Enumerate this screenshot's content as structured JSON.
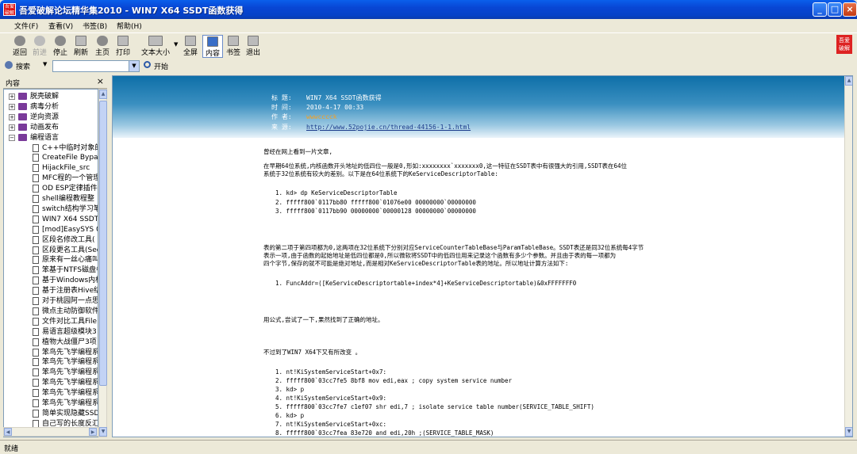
{
  "window": {
    "title": "吾爱破解论坛精华集2010 - WIN7 X64 SSDT函数获得",
    "icon_text": "吾爱破解",
    "controls": [
      "_",
      "□",
      "×"
    ]
  },
  "menu": [
    "文件(F)",
    "查看(V)",
    "书签(B)",
    "帮助(H)"
  ],
  "toolbar": [
    {
      "label": "返回",
      "icon": "back-icon"
    },
    {
      "label": "前进",
      "icon": "forward-icon"
    },
    {
      "label": "停止",
      "icon": "stop-icon"
    },
    {
      "label": "刷新",
      "icon": "refresh-icon"
    },
    {
      "label": "主页",
      "icon": "home-icon"
    },
    {
      "label": "打印",
      "icon": "print-icon"
    },
    {
      "label": "文本大小",
      "icon": "font-size-icon"
    },
    {
      "label": "全屏",
      "icon": "fullscreen-icon"
    },
    {
      "label": "内容",
      "icon": "contents-icon"
    },
    {
      "label": "书签",
      "icon": "bookmark-icon"
    },
    {
      "label": "退出",
      "icon": "exit-icon"
    }
  ],
  "logo_text": "吾爱破解",
  "search": {
    "label": "搜索",
    "go_label": "开始",
    "value": ""
  },
  "panel": {
    "title": "内容",
    "close": "×"
  },
  "tree": [
    {
      "label": "脱壳破解",
      "level": 0,
      "type": "book"
    },
    {
      "label": "病毒分析",
      "level": 0,
      "type": "book"
    },
    {
      "label": "逆向资源",
      "level": 0,
      "type": "book"
    },
    {
      "label": "动画发布",
      "level": 0,
      "type": "book"
    },
    {
      "label": "编程语言",
      "level": 0,
      "type": "book-open"
    },
    {
      "label": "C++中临时对象的",
      "level": 1,
      "type": "doc"
    },
    {
      "label": "CreateFile Bypas",
      "level": 1,
      "type": "doc"
    },
    {
      "label": "HijackFile_src",
      "level": 1,
      "type": "doc"
    },
    {
      "label": "MFC程的一个管理",
      "level": 1,
      "type": "doc"
    },
    {
      "label": "OD ESP定律插件(",
      "level": 1,
      "type": "doc"
    },
    {
      "label": "shell编程教程整",
      "level": 1,
      "type": "doc"
    },
    {
      "label": "switch结构学习笔",
      "level": 1,
      "type": "doc"
    },
    {
      "label": "WIN7 X64 SSDT函",
      "level": 1,
      "type": "doc"
    },
    {
      "label": "[mod]EasySYS 0.3",
      "level": 1,
      "type": "doc"
    },
    {
      "label": "区段名修改工具(",
      "level": 1,
      "type": "doc"
    },
    {
      "label": "区段更名工具(Sec",
      "level": 1,
      "type": "doc"
    },
    {
      "label": "原来有一丝心痛叫",
      "level": 1,
      "type": "doc"
    },
    {
      "label": "笨基于NTFS磁盘卷",
      "level": 1,
      "type": "doc"
    },
    {
      "label": "基于Windows内核",
      "level": 1,
      "type": "doc"
    },
    {
      "label": "基于注册表Hive结",
      "level": 1,
      "type": "doc"
    },
    {
      "label": "对于桃园阿一点思",
      "level": 1,
      "type": "doc"
    },
    {
      "label": "微点主动防御软件",
      "level": 1,
      "type": "doc"
    },
    {
      "label": "文件对比工具File",
      "level": 1,
      "type": "doc"
    },
    {
      "label": "易语言超级模块3",
      "level": 1,
      "type": "doc"
    },
    {
      "label": "植物大战僵尸3项",
      "level": 1,
      "type": "doc"
    },
    {
      "label": "笨鸟先飞学编程系",
      "level": 1,
      "type": "doc"
    },
    {
      "label": "笨鸟先飞学编程系",
      "level": 1,
      "type": "doc"
    },
    {
      "label": "笨鸟先飞学编程系",
      "level": 1,
      "type": "doc"
    },
    {
      "label": "笨鸟先飞学编程系",
      "level": 1,
      "type": "doc"
    },
    {
      "label": "笨鸟先飞学编程系",
      "level": 1,
      "type": "doc"
    },
    {
      "label": "笨鸟先飞学编程系",
      "level": 1,
      "type": "doc"
    },
    {
      "label": "简单实现隐藏SSD",
      "level": 1,
      "type": "doc"
    },
    {
      "label": "自己写的长度反汇",
      "level": 1,
      "type": "doc"
    }
  ],
  "article": {
    "meta": [
      {
        "label": "标  题:",
        "value": "WIN7 X64 SSDT函数获得",
        "style": "plain"
      },
      {
        "label": "时  间:",
        "value": "2010-4-17 00:33",
        "style": "plain"
      },
      {
        "label": "作  者:",
        "value": "wwwcccck",
        "style": "orange"
      },
      {
        "label": "来  源:",
        "value": "http://www.52pojie.cn/thread-44156-1-1.html",
        "style": "link"
      }
    ],
    "lines": [
      "曾经在网上看到一片文章,",
      "在早期64位系统,内核函数开头地址的低四位一般是0,形如:xxxxxxxx`xxxxxxx0,这一特征在SSDT表中有很强大的引用,SSDT表在64位",
      "系统于32位系统有较大的差别。以下是在64位系统下的KeServiceDescriptorTable:",
      "1.   kd> dp KeServiceDescriptorTable",
      "2.   fffff800`0117bb80   fffff800`01076e00 00000000`00000000",
      "3.   fffff800`0117bb90   00000000`00000128 00000000`00000000",
      "表的第二项于第四项都为0,这两项在32位系统下分别对应ServiceCounterTableBase与ParamTableBase。SSDT表还是同32位系统每4字节",
      "表示一项,由于函数的起始地址是低四位都是0,所以微软将SSDT中的低四位用来记录这个函数有多少个参数。并且由于表的每一项都为",
      "四个字节,保存的就不可能是绝对地址,而是相对KeServiceDescriptorTable表的地址。所以地址计算方法如下:",
      "1.   FuncAddr=([KeServiceDescriptortable+index*4]+KeServiceDescriptortable)&0xFFFFFFF0",
      "用公式,尝试了一下,果然找到了正确的地址。",
      "不过到了WIN7 X64下又有所改变 。",
      "1.   nt!KiSystemServiceStart+0x7:",
      "2.   fffff800`03cc7fe5 8bf8           mov     edi,eax ; copy system service number",
      "3.   kd> p",
      "4.   nt!KiSystemServiceStart+0x9:",
      "5.   fffff800`03cc7fe7 c1ef07         shr     edi,7   ; isolate service table number(SERVICE_TABLE_SHIFT)",
      "6.   kd> p",
      "7.   nt!KiSystemServiceStart+0xc:",
      "8.   fffff800`03cc7fea 83e720         and     edi,20h ;(SERVICE_TABLE_MASK)",
      "9.   kd> p"
    ]
  },
  "status": "就绪"
}
